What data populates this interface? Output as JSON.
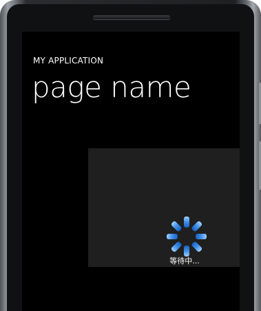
{
  "app": {
    "title": "MY APPLICATION",
    "page_name": "page name"
  },
  "loading": {
    "text": "等待中..."
  },
  "colors": {
    "screen_bg": "#000000",
    "panel_bg": "#1f1f1f",
    "text": "#ffffff",
    "spinner": "#3f8fe6"
  },
  "icons": {
    "spinner": "loading-spinner-icon"
  }
}
